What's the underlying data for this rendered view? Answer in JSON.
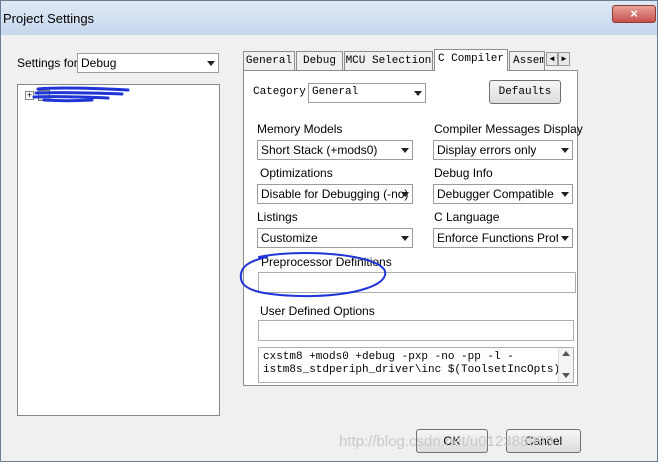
{
  "window": {
    "title": "Project Settings",
    "close_glyph": "×"
  },
  "settings_for": {
    "label": "Settings for:",
    "value": "Debug"
  },
  "tree": {
    "expander": "+"
  },
  "tabs": [
    {
      "label": "General"
    },
    {
      "label": "Debug"
    },
    {
      "label": "MCU Selection"
    },
    {
      "label": "C Compiler"
    },
    {
      "label": "Assembl"
    }
  ],
  "tab_scroll": {
    "left": "◄",
    "right": "►"
  },
  "category": {
    "label": "Category",
    "value": "General"
  },
  "defaults_button": "Defaults",
  "memory_models": {
    "label": "Memory Models",
    "value": "Short Stack (+mods0)"
  },
  "compiler_messages": {
    "label": "Compiler Messages Display",
    "value": "Display errors only"
  },
  "optimizations": {
    "label": "Optimizations",
    "value": "Disable for Debugging (-no)"
  },
  "debug_info": {
    "label": "Debug Info",
    "value": "Debugger Compatible"
  },
  "listings": {
    "label": "Listings",
    "value": "Customize"
  },
  "c_language": {
    "label": "C Language",
    "value": "Enforce Functions Protot"
  },
  "preprocessor": {
    "label": "Preprocessor Definitions",
    "value": ""
  },
  "user_options": {
    "label": "User Defined Options",
    "value": ""
  },
  "command_line": {
    "line1": "cxstm8 +mods0 +debug -pxp -no -pp -l -",
    "line2": "istm8s_stdperiph_driver\\inc $(ToolsetIncOpts) -"
  },
  "ok_button": "OK",
  "cancel_button": "Cancel",
  "watermark": "http://blog.csdn.net/u012388993",
  "colors": {
    "annotation": "#1f35d6",
    "window_bg": "#f0f0f0",
    "titlebar": "#c6d7ec"
  }
}
